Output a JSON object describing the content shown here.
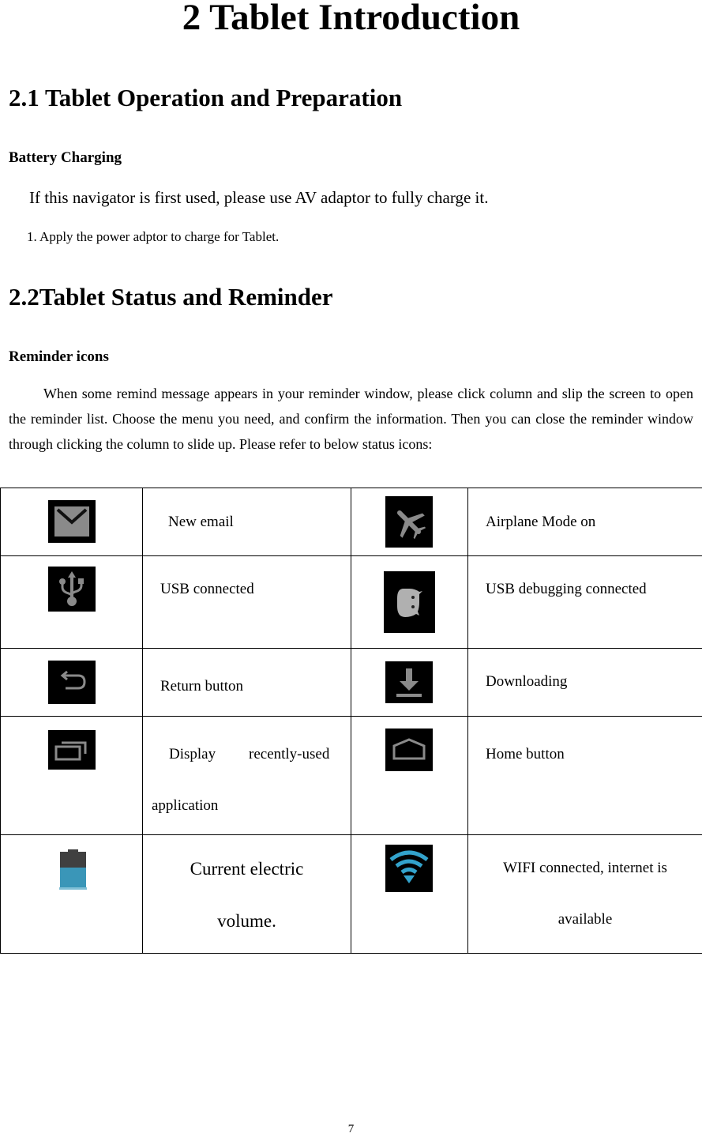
{
  "document": {
    "chapter_title": "2 Tablet Introduction",
    "section_1": {
      "heading": "2.1 Tablet Operation and Preparation",
      "subheading": "Battery Charging",
      "lead": "If this navigator is first used, please use AV adaptor to fully charge it.",
      "step_1": "1. Apply the power adptor to charge for Tablet."
    },
    "section_2": {
      "heading": "2.2Tablet Status and Reminder",
      "subheading": "Reminder icons",
      "paragraph": "When some remind message appears in your reminder window, please click column and slip the screen to open the reminder list. Choose the menu you need, and confirm the information. Then you can close the reminder window through clicking the column to slide up. Please refer to below status icons:"
    },
    "icon_table": {
      "rows": [
        {
          "left": {
            "icon": "email-icon",
            "label": "New email"
          },
          "right": {
            "icon": "airplane-icon",
            "label": "Airplane Mode on"
          }
        },
        {
          "left": {
            "icon": "usb-icon",
            "label": "USB connected"
          },
          "right": {
            "icon": "usb-debugging-icon",
            "label": "USB debugging connected"
          }
        },
        {
          "left": {
            "icon": "return-icon",
            "label": "Return button"
          },
          "right": {
            "icon": "download-icon",
            "label": "Downloading"
          }
        },
        {
          "left": {
            "icon": "recent-apps-icon",
            "label_line1_a": "Display",
            "label_line1_b": "recently-used",
            "label_line2": "application"
          },
          "right": {
            "icon": "home-icon",
            "label": "Home button"
          }
        },
        {
          "left": {
            "icon": "battery-icon",
            "label_line1": "Current electric",
            "label_line2": "volume."
          },
          "right": {
            "icon": "wifi-icon",
            "label_line1": "WIFI connected, internet is",
            "label_line2": "available"
          }
        }
      ]
    },
    "page_number": "7",
    "colors": {
      "icon_bg": "#000000",
      "icon_gray": "#8a8a8a",
      "accent_blue": "#33a3cc",
      "battery_empty": "#404040"
    }
  }
}
